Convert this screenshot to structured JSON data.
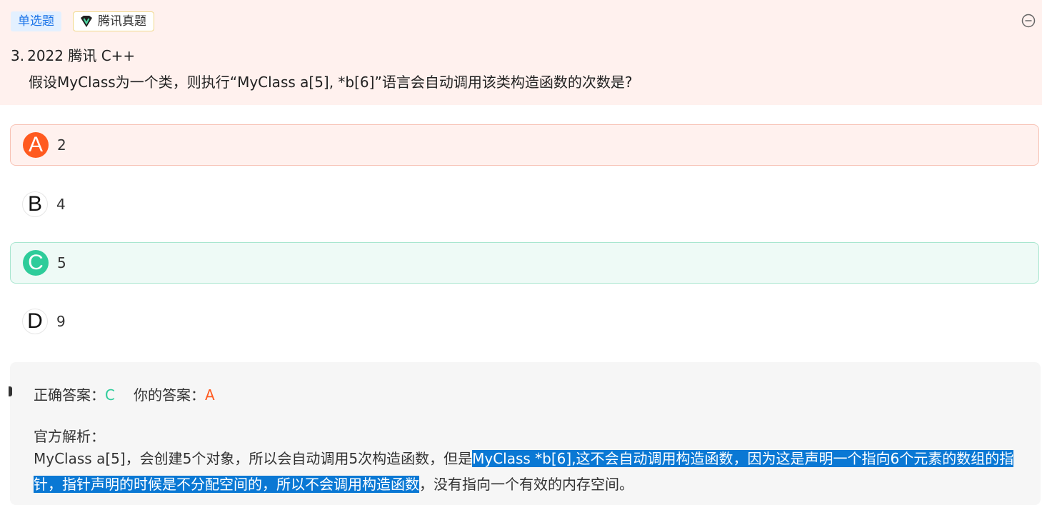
{
  "question": {
    "type_tag": "单选题",
    "source_tag": "腾讯真题",
    "number": "3.",
    "title": "2022 腾讯 C++",
    "stem": "假设MyClass为一个类，则执行“MyClass a[5], *b[6]”语言会自动调用该类构造函数的次数是?"
  },
  "options": [
    {
      "letter": "A",
      "text": "2",
      "state": "wrong"
    },
    {
      "letter": "B",
      "text": "4",
      "state": "normal"
    },
    {
      "letter": "C",
      "text": "5",
      "state": "correct"
    },
    {
      "letter": "D",
      "text": "9",
      "state": "normal"
    }
  ],
  "answer": {
    "correct_label": "正确答案：",
    "correct_value": "C",
    "yours_label": "你的答案：",
    "yours_value": "A",
    "explanation_label": "官方解析：",
    "explanation_part1": "MyClass a[5]，会创建5个对象，所以会自动调用5次构造函数，但是",
    "explanation_highlight": "MyClass *b[6],这不会自动调用构造函数，因为这是声明一个指向6个元素的数组的指针，指针声明的时候是不分配空间的，所以不会调用构造函数",
    "explanation_part2": "，没有指向一个有效的内存空间。"
  },
  "colors": {
    "header_bg": "#fff1ee",
    "wrong": "#ff5a1f",
    "correct": "#2ecc9a",
    "highlight": "#0a78d4"
  },
  "icons": {
    "source": "v-badge-icon",
    "collapse": "minus-circle-icon"
  }
}
